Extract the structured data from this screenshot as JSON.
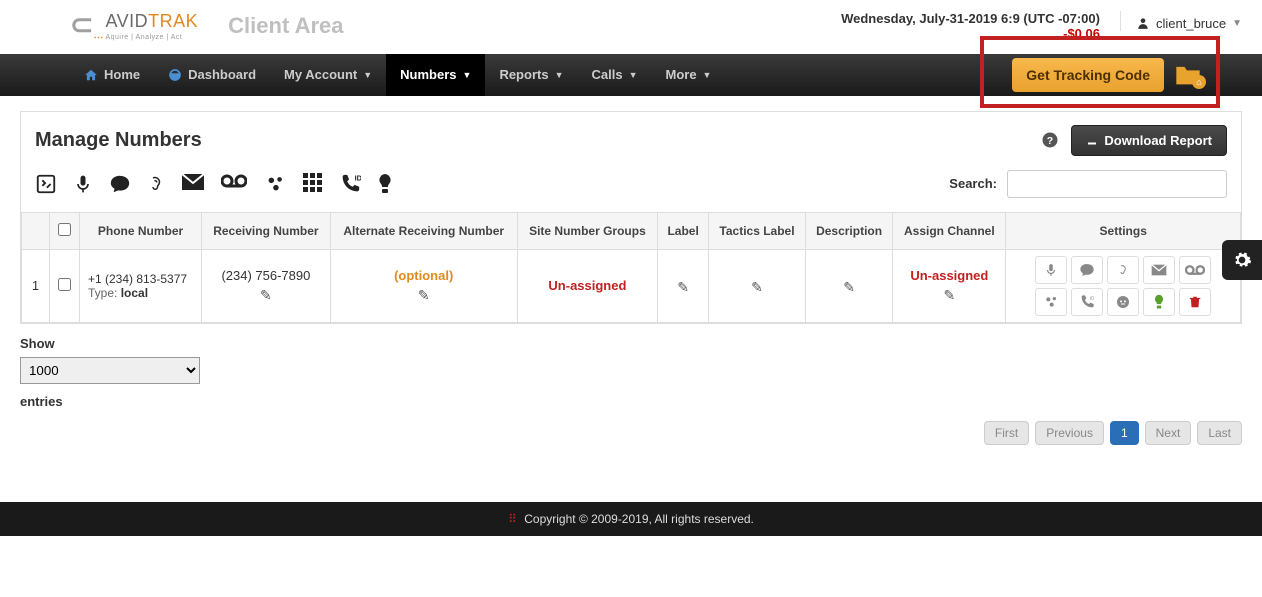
{
  "brand": {
    "name_primary": "AVID",
    "name_secondary": "TRAK",
    "tagline": "Aquire | Analyze | Act"
  },
  "header": {
    "client_area": "Client Area",
    "datetime": "Wednesday, July-31-2019 6:9 (UTC -07:00)",
    "balance": "-$0.06",
    "username": "client_bruce"
  },
  "nav": {
    "home": "Home",
    "dashboard": "Dashboard",
    "my_account": "My Account",
    "numbers": "Numbers",
    "reports": "Reports",
    "calls": "Calls",
    "more": "More",
    "tracking_btn": "Get Tracking Code"
  },
  "panel": {
    "title": "Manage Numbers",
    "download": "Download Report",
    "search_label": "Search:"
  },
  "table": {
    "headers": {
      "phone_number": "Phone Number",
      "receiving_number": "Receiving Number",
      "alt_receiving": "Alternate Receiving Number",
      "site_groups": "Site Number Groups",
      "label": "Label",
      "tactics_label": "Tactics Label",
      "description": "Description",
      "assign_channel": "Assign Channel",
      "settings": "Settings"
    },
    "row": {
      "index": "1",
      "phone": "+1 (234) 813-5377",
      "type_label": "Type: ",
      "type_value": "local",
      "receiving": "(234) 756-7890",
      "alt_receiving": "(optional)",
      "site_groups": "Un-assigned",
      "assign_channel": "Un-assigned"
    }
  },
  "below": {
    "show": "Show",
    "entries": "entries",
    "select_value": "1000"
  },
  "pagination": {
    "first": "First",
    "prev": "Previous",
    "page": "1",
    "next": "Next",
    "last": "Last"
  },
  "footer": {
    "text": "Copyright © 2009-2019, All rights reserved."
  }
}
